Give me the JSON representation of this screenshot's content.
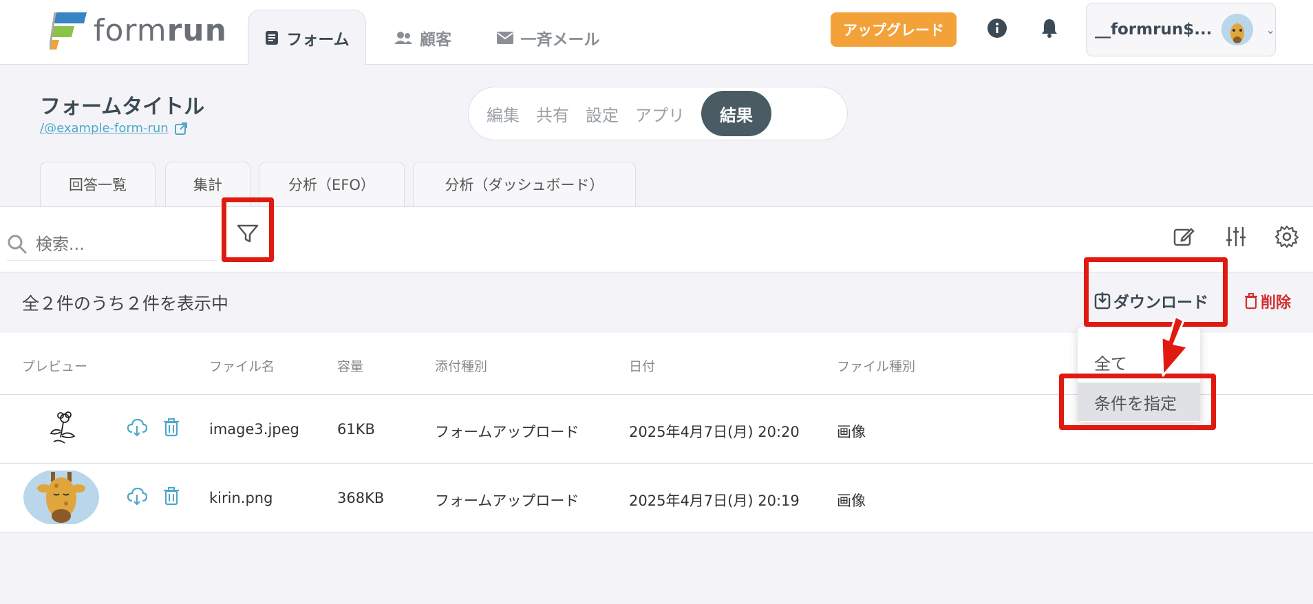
{
  "app": {
    "logo_text_light": "form",
    "logo_text_bold": "run",
    "logo_colors": [
      "#3a83c4",
      "#8bc34a",
      "#f3a23a"
    ]
  },
  "nav": {
    "tabs": [
      {
        "label": "フォーム",
        "icon": "form-doc-icon",
        "active": true
      },
      {
        "label": "顧客",
        "icon": "people-icon",
        "active": false
      },
      {
        "label": "一斉メール",
        "icon": "mail-icon",
        "active": false
      }
    ],
    "upgrade_label": "アップグレード",
    "user_name": "__formrun$..."
  },
  "form": {
    "title": "フォームタイトル",
    "link": "/@example-form-run"
  },
  "segment": {
    "items": [
      "編集",
      "共有",
      "設定",
      "アプリ",
      "結果"
    ],
    "active": "結果"
  },
  "subtabs": [
    "回答一覧",
    "集計",
    "分析（EFO）",
    "分析（ダッシュボード）"
  ],
  "search": {
    "placeholder": "検索..."
  },
  "results": {
    "count_text": "全２件のうち２件を表示中",
    "download_label": "ダウンロード",
    "delete_label": "削除"
  },
  "table": {
    "headers": [
      "プレビュー",
      "ファイル名",
      "容量",
      "添付種別",
      "日付",
      "ファイル種別"
    ],
    "rows": [
      {
        "file_name": "image3.jpeg",
        "size": "61KB",
        "attach_type": "フォームアップロード",
        "date": "2025年4月7日(月) 20:20",
        "file_type": "画像",
        "preview": "flower-sketch"
      },
      {
        "file_name": "kirin.png",
        "size": "368KB",
        "attach_type": "フォームアップロード",
        "date": "2025年4月7日(月) 20:19",
        "file_type": "画像",
        "preview": "giraffe-illustration"
      }
    ]
  },
  "dropdown": {
    "items": [
      "全て",
      "条件を指定"
    ],
    "highlighted": "条件を指定"
  },
  "colors": {
    "accent": "#f3a23a",
    "segment_active": "#4b5b63",
    "link": "#4fa8c9",
    "danger": "#d03030",
    "annotation": "#e01a10"
  }
}
